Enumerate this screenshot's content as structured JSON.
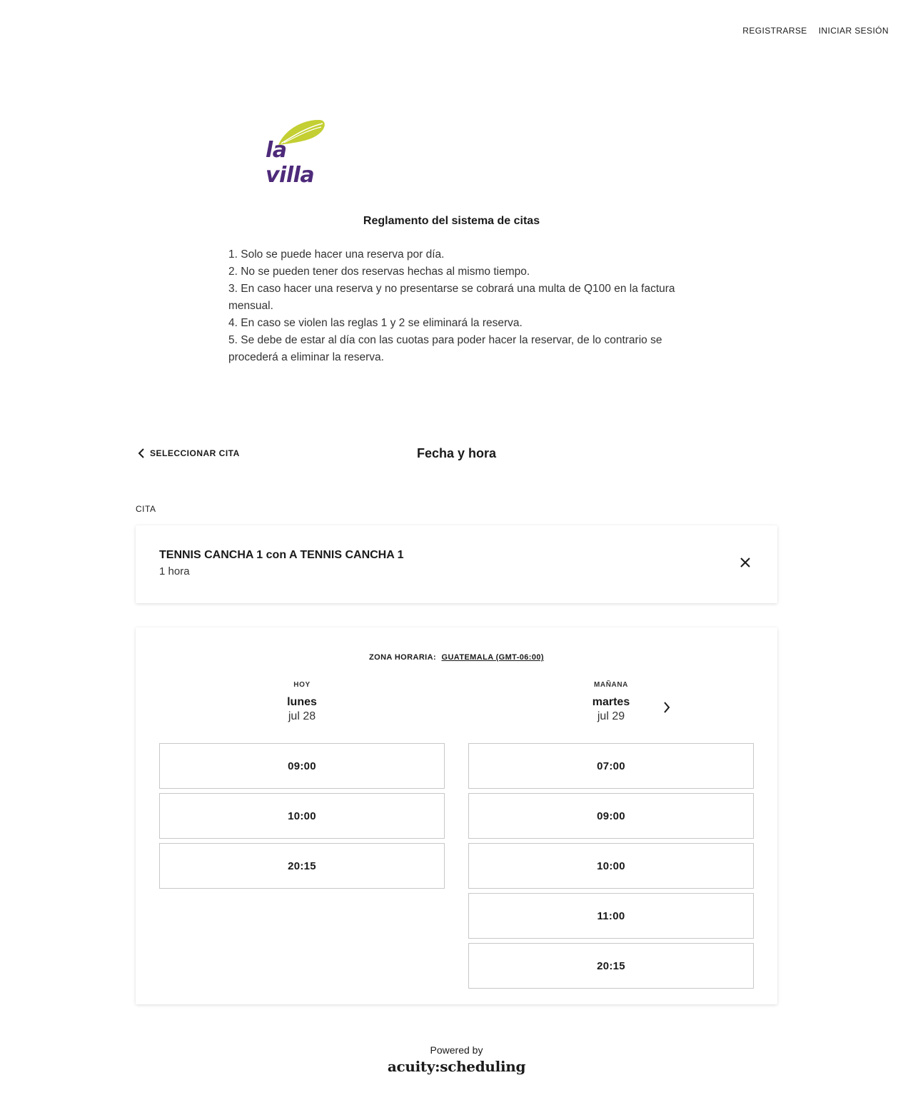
{
  "nav": {
    "register": "REGISTRARSE",
    "login": "INICIAR SESIÓN"
  },
  "logo": {
    "text": "la villa",
    "leaf_color": "#c3cf32",
    "text_color": "#4e2a7a"
  },
  "rules": {
    "title": "Reglamento del sistema de citas",
    "items": [
      "1. Solo se puede hacer una reserva por día.",
      "2. No se pueden tener dos reservas hechas al mismo tiempo.",
      "3. En caso hacer una reserva y no presentarse se cobrará una multa de Q100 en la factura mensual.",
      "4. En caso se violen las reglas 1 y 2 se eliminará la reserva.",
      "5. Se debe de estar al día con las cuotas para poder hacer la reservar, de lo contrario se procederá a eliminar la reserva."
    ]
  },
  "step": {
    "back_label": "SELECCIONAR CITA",
    "title": "Fecha y hora"
  },
  "appointment": {
    "section_label": "CITA",
    "name": "TENNIS CANCHA 1 con A TENNIS CANCHA 1",
    "duration": "1 hora"
  },
  "calendar": {
    "timezone_label": "ZONA HORARIA:",
    "timezone_value": "GUATEMALA (GMT-06:00)",
    "days": [
      {
        "tag": "HOY",
        "name": "lunes",
        "date": "jul 28",
        "slots": [
          "09:00",
          "10:00",
          "20:15"
        ]
      },
      {
        "tag": "MAÑANA",
        "name": "martes",
        "date": "jul 29",
        "slots": [
          "07:00",
          "09:00",
          "10:00",
          "11:00",
          "20:15"
        ]
      }
    ]
  },
  "footer": {
    "powered_by": "Powered by",
    "brand": "acuity:scheduling"
  }
}
